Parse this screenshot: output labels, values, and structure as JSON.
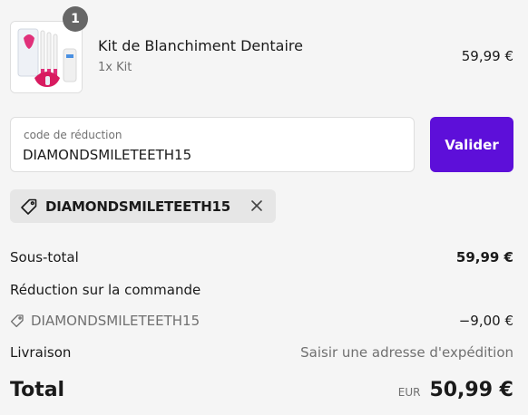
{
  "product": {
    "quantity_badge": "1",
    "name": "Kit de Blanchiment Dentaire",
    "variant": "1x Kit",
    "price": "59,99 €",
    "thumbnail_icon": "teeth-whitening-kit-image"
  },
  "discount": {
    "field_label": "code de réduction",
    "field_value": "DIAMONDSMILETEETH15",
    "apply_label": "Valider",
    "applied_code": "DIAMONDSMILETEETH15",
    "tag_icon": "tag-icon",
    "remove_icon": "close-icon"
  },
  "summary": {
    "subtotal_label": "Sous-total",
    "subtotal_value": "59,99 €",
    "order_discount_label": "Réduction sur la commande",
    "discount_code": "DIAMONDSMILETEETH15",
    "discount_value": "−9,00 €",
    "shipping_label": "Livraison",
    "shipping_value": "Saisir une adresse d'expédition",
    "total_label": "Total",
    "currency": "EUR",
    "total_value": "50,99 €"
  },
  "colors": {
    "accent": "#5d0fd9",
    "background": "#f5f5f5",
    "chip": "#e6e6e6",
    "muted_text": "#707070"
  }
}
